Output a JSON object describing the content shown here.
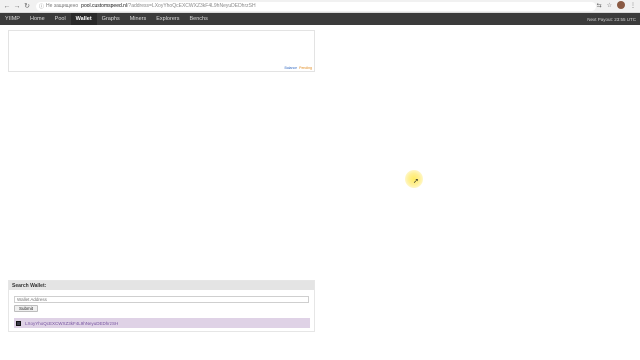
{
  "browser": {
    "insecure_label": "Не защищено",
    "url_host": "pool.customspeed.nl",
    "url_path": "/?address=LXoyYhoQcEXCWXZ3kF4L9hNeyuDEDhrzSH"
  },
  "nav": {
    "brand": "YIIMP",
    "items": [
      "Home",
      "Pool",
      "Wallet",
      "Graphs",
      "Miners",
      "Explorers",
      "Benchs"
    ],
    "active": "Wallet",
    "next_payout": "Next Payout: 23:55 UTC"
  },
  "chart": {
    "legend": [
      "Balance",
      "Pending"
    ]
  },
  "search": {
    "title": "Search Wallet:",
    "placeholder": "Wallet Address",
    "submit_label": "Submit",
    "result_address": "LXoyYhoQcEXCWXZ3kF4L9hNeyuDEDhrzSH"
  },
  "colors": {
    "nav_bg": "#3b3b3b",
    "highlight_row": "#dfd2e6",
    "address_link": "#7653a0",
    "balance": "#3a6fc4",
    "pending": "#e08a1e",
    "cursor_highlight": "#ffe65a"
  }
}
